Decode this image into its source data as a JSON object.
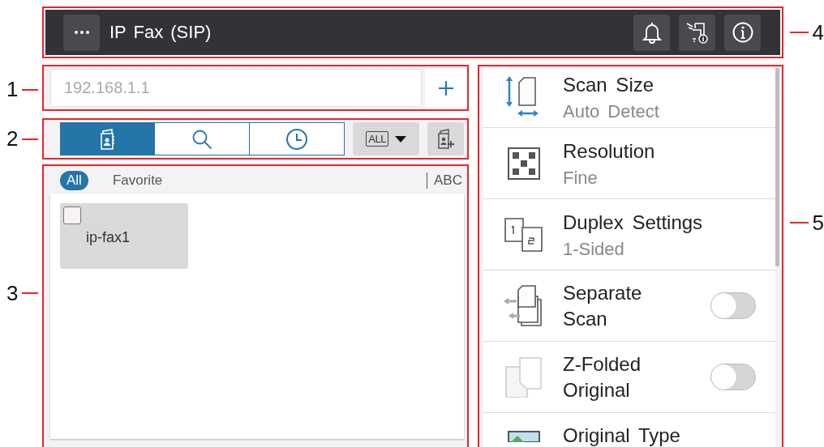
{
  "header": {
    "title": "IP Fax (SIP)"
  },
  "address_field": {
    "placeholder": "192.168.1.1"
  },
  "tabs": [
    {
      "selected": true
    },
    {
      "selected": false
    },
    {
      "selected": false
    }
  ],
  "range_dropdown": {
    "label": "ALL"
  },
  "filters": [
    {
      "label": "All",
      "selected": true
    },
    {
      "label": "Favorite",
      "selected": false
    }
  ],
  "index_label": "ABC",
  "destinations": [
    {
      "name": "ip-fax1",
      "checked": false
    }
  ],
  "settings": [
    {
      "kind": "value",
      "title": "Scan Size",
      "value": "Auto Detect"
    },
    {
      "kind": "value",
      "title": "Resolution",
      "value": "Fine"
    },
    {
      "kind": "value",
      "title": "Duplex Settings",
      "value": "1-Sided"
    },
    {
      "kind": "toggle",
      "title": "Separate Scan",
      "on": false
    },
    {
      "kind": "toggle",
      "title": "Z-Folded Original",
      "on": false
    },
    {
      "kind": "value",
      "title": "Original Type"
    }
  ],
  "callouts": [
    "1",
    "2",
    "3",
    "4",
    "5"
  ]
}
